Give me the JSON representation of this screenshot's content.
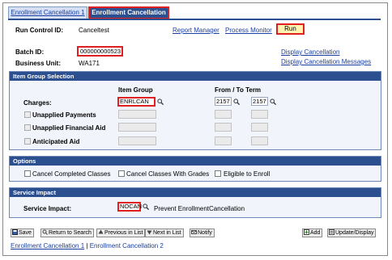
{
  "tabs": [
    {
      "label": "Enrollment Cancellation 1",
      "active": false
    },
    {
      "label": "Enrollment Cancellation 2",
      "active": true
    }
  ],
  "header": {
    "run_control_label": "Run Control ID:",
    "run_control_value": "Canceltest",
    "report_manager": "Report Manager",
    "process_monitor": "Process Monitor",
    "run_button": "Run"
  },
  "batch": {
    "batch_id_label": "Batch ID:",
    "batch_id_value": "000000000523",
    "business_unit_label": "Business Unit:",
    "business_unit_value": "WA171",
    "display_cancellation": "Display Cancellation",
    "display_cancellation_messages": "Display Cancellation Messages"
  },
  "item_group_section": {
    "title": "Item Group Selection",
    "col_item_group": "Item Group",
    "col_from_to_term": "From / To Term",
    "charges_label": "Charges:",
    "charges_item_group": "ENRLCAN",
    "charges_from_term": "2157",
    "charges_to_term": "2157",
    "unapplied_payments": "Unapplied Payments",
    "unapplied_financial_aid": "Unapplied Financial Aid",
    "anticipated_aid": "Anticipated Aid"
  },
  "options_section": {
    "title": "Options",
    "cancel_completed_classes": "Cancel Completed Classes",
    "cancel_classes_with_grades": "Cancel Classes With Grades",
    "eligible_to_enroll": "Eligible to Enroll"
  },
  "service_impact_section": {
    "title": "Service Impact",
    "label": "Service Impact:",
    "value": "NOCAN",
    "description": "Prevent EnrollmentCancellation"
  },
  "toolbar": {
    "save": "Save",
    "return_to_search": "Return to Search",
    "previous_in_list": "Previous in List",
    "next_in_list": "Next in List",
    "notify": "Notify",
    "add": "Add",
    "update_display": "Update/Display"
  },
  "footer": {
    "link1": "Enrollment Cancellation 1",
    "separator": " | ",
    "link2": "Enrollment Cancellation 2"
  },
  "colors": {
    "section_header": "#2c4f8f",
    "highlight": "#e02020",
    "run_button_bg": "#fdf3b0",
    "link": "#1a3fa0"
  }
}
